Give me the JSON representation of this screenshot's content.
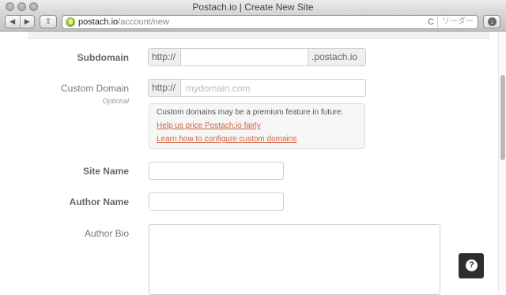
{
  "window": {
    "title": "Postach.io | Create New Site"
  },
  "toolbar": {
    "back_icon": "◀",
    "forward_icon": "▶",
    "share_icon": "⇪",
    "url_host": "postach.io",
    "url_path": "/account/new",
    "reload_icon": "C",
    "reader_label": "リーダー"
  },
  "form": {
    "subdomain": {
      "label": "Subdomain",
      "prefix": "http://",
      "value": "",
      "suffix": ".postach.io"
    },
    "custom_domain": {
      "label": "Custom Domain",
      "sublabel": "Optional",
      "prefix": "http://",
      "placeholder": "mydomain.com",
      "value": ""
    },
    "info": {
      "text": "Custom domains may be a premium feature in future.",
      "link1": "Help us price Postach.io fairly",
      "link2": "Learn how to configure custom domains"
    },
    "site_name": {
      "label": "Site Name",
      "value": ""
    },
    "author_name": {
      "label": "Author Name",
      "value": ""
    },
    "author_bio": {
      "label": "Author Bio",
      "value": ""
    }
  },
  "help": {
    "icon": "?"
  },
  "colors": {
    "link": "#d2603c",
    "help_button": "#2e2e2e"
  }
}
